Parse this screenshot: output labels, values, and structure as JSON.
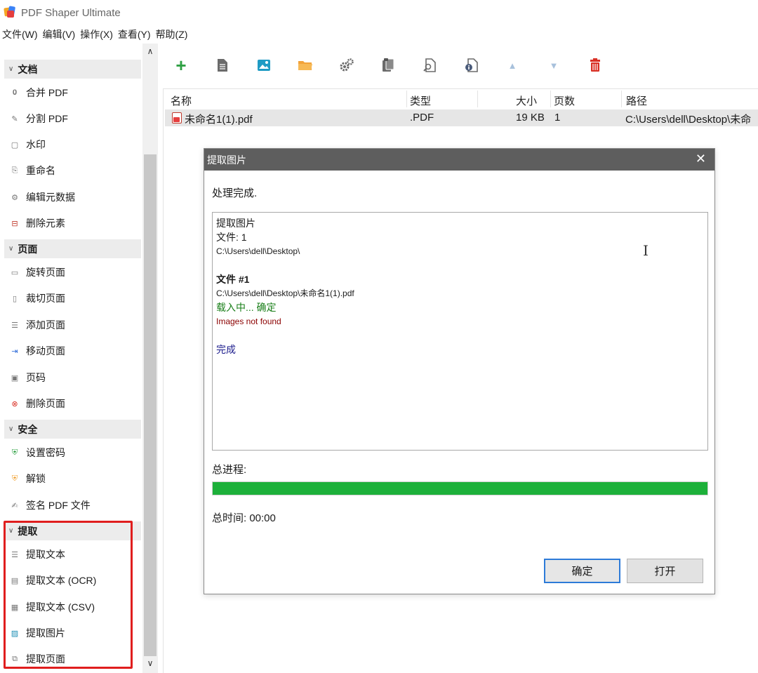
{
  "window": {
    "title": "PDF Shaper Ultimate"
  },
  "menu": [
    "文件(W)",
    "编辑(V)",
    "操作(X)",
    "查看(Y)",
    "帮助(Z)"
  ],
  "sidebar": {
    "groups": [
      {
        "label": "文档",
        "items": [
          "合并 PDF",
          "分割 PDF",
          "水印",
          "重命名",
          "编辑元数据",
          "删除元素"
        ]
      },
      {
        "label": "页面",
        "items": [
          "旋转页面",
          "裁切页面",
          "添加页面",
          "移动页面",
          "页码",
          "删除页面"
        ]
      },
      {
        "label": "安全",
        "items": [
          "设置密码",
          "解锁",
          "签名 PDF 文件"
        ]
      },
      {
        "label": "提取",
        "items": [
          "提取文本",
          "提取文本 (OCR)",
          "提取文本 (CSV)",
          "提取图片",
          "提取页面"
        ]
      }
    ]
  },
  "toolbar": {
    "icons": [
      "add-icon",
      "document-icon",
      "image-icon",
      "folder-icon",
      "settings-icon",
      "clipboard-icon",
      "preview-icon",
      "info-icon",
      "move-up-icon",
      "move-down-icon",
      "delete-icon"
    ]
  },
  "file_list": {
    "columns": [
      "名称",
      "类型",
      "大小",
      "页数",
      "路径"
    ],
    "rows": [
      {
        "name": "未命名1(1).pdf",
        "type": ".PDF",
        "size": "19 KB",
        "pages": "1",
        "path": "C:\\Users\\dell\\Desktop\\未命"
      }
    ]
  },
  "dialog": {
    "title": "提取图片",
    "status": "处理完成.",
    "log": {
      "line1": "提取图片",
      "line2": "文件: 1",
      "line3": "C:\\Users\\dell\\Desktop\\",
      "file_header": "文件 #1",
      "file_path": "C:\\Users\\dell\\Desktop\\未命名1(1).pdf",
      "loading": "载入中... 确定",
      "error": "Images not found",
      "done": "完成"
    },
    "progress_label": "总进程:",
    "progress_value": 1.0,
    "time_label": "总时间: 00:00",
    "ok_button": "确定",
    "open_button": "打开"
  },
  "colors": {
    "progress": "#1db03a",
    "highlight": "#e01e1e",
    "dialog_title_bg": "#5e5e5e",
    "add": "#2ea043",
    "delete": "#d93025"
  }
}
